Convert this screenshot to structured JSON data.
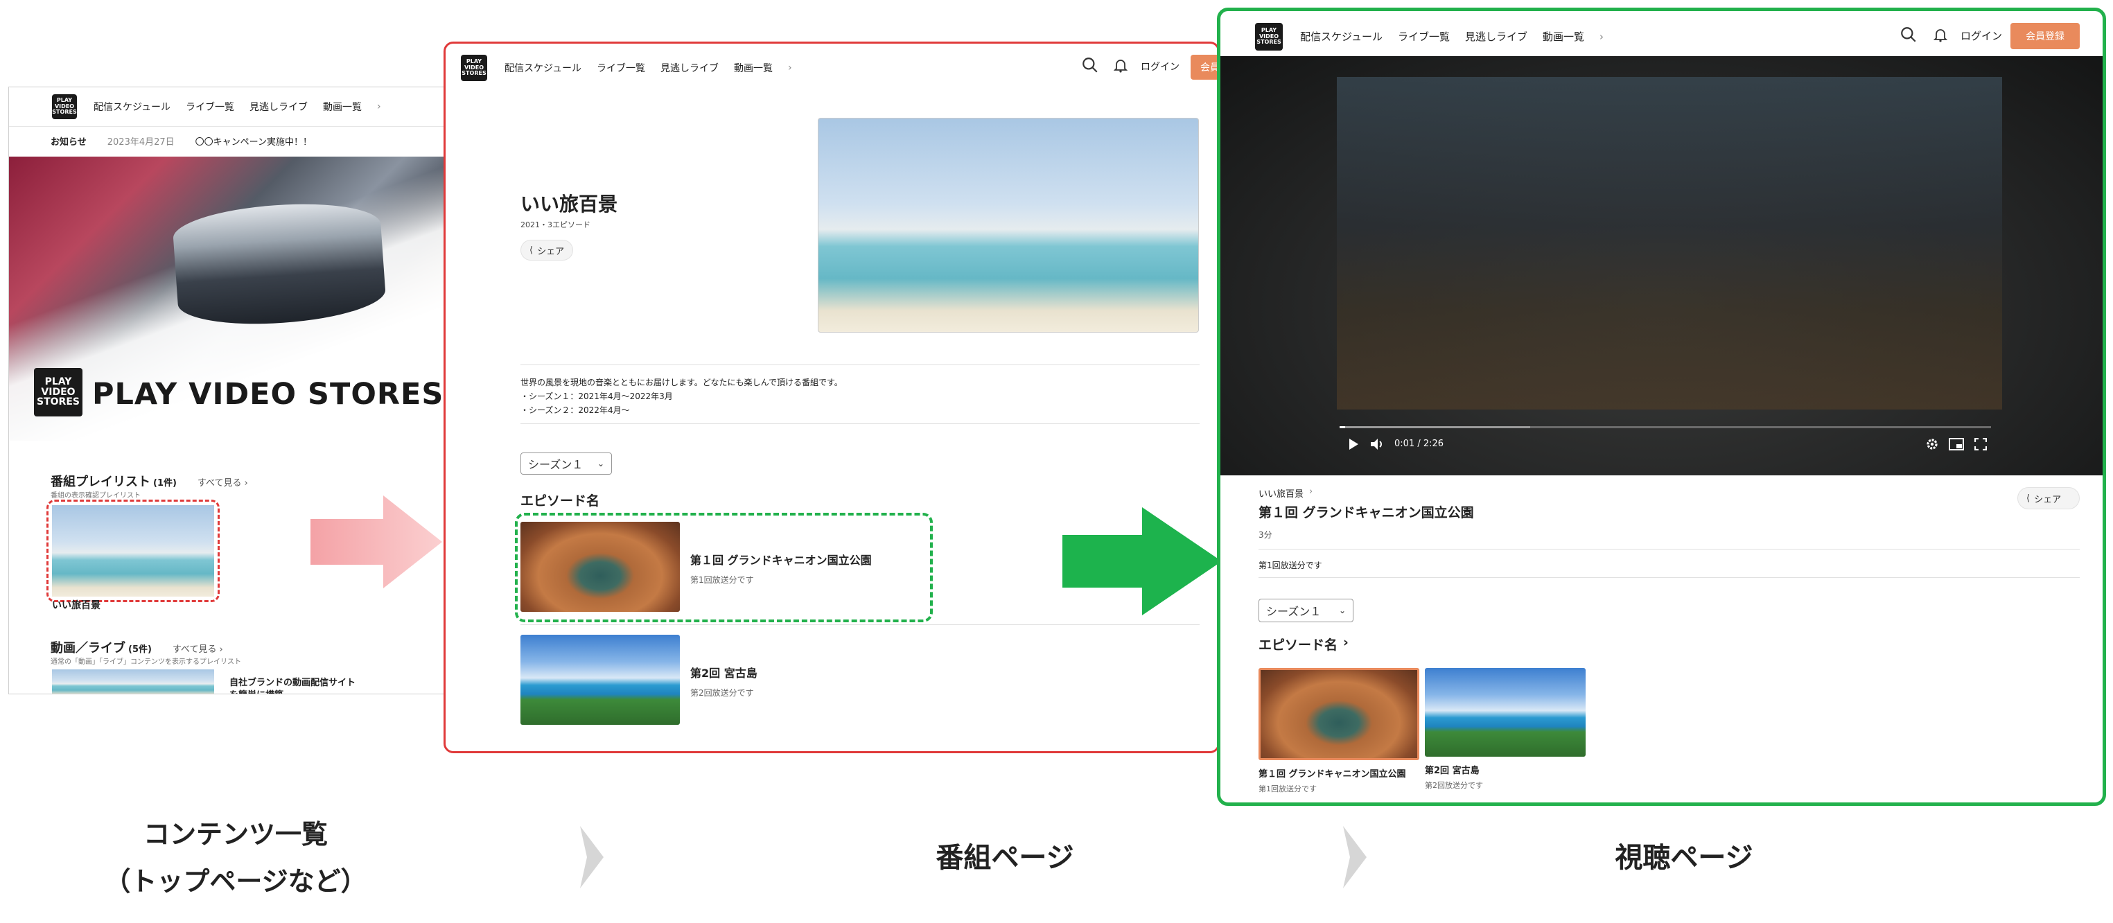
{
  "nav": {
    "schedule": "配信スケジュール",
    "live_list": "ライブ一覧",
    "missed_live": "見逃しライブ",
    "video_list": "動画一覧",
    "login": "ログイン",
    "register": "会員登録"
  },
  "logo": {
    "line1": "PLAY",
    "line2": "VIDEO",
    "line3": "STORES"
  },
  "panel1": {
    "notice_label": "お知らせ",
    "notice_date": "2023年4月27日",
    "notice_text": "〇〇キャンペーン実施中！！",
    "hero_title": "PLAY VIDEO STORES",
    "playlist_title": "番組プレイリスト",
    "playlist_count": "(1件)",
    "see_all": "すべて見る",
    "playlist_sub": "番組の表示確認プレイリスト",
    "playlist_item": "いい旅百景",
    "video_title": "動画／ライブ",
    "video_count": "(5件)",
    "video_sub": "通常の「動画」「ライブ」コンテンツを表示するプレイリスト",
    "video_item": "自社ブランドの動画配信サイト",
    "video_item2": "を簡単に構築"
  },
  "panel2": {
    "program_title": "いい旅百景",
    "program_meta": "2021・3エピソード",
    "share": "シェア",
    "desc1": "世界の風景を現地の音楽とともにお届けします。どなたにも楽しんで頂ける番組です。",
    "desc2": "・シーズン１：2021年4月〜2022年3月",
    "desc3": "・シーズン２：2022年4月〜",
    "season": "シーズン１",
    "episodes_heading": "エピソード名",
    "ep1_title": "第１回 グランドキャニオン国立公園",
    "ep1_sub": "第1回放送分です",
    "ep2_title": "第2回 宮古島",
    "ep2_sub": "第2回放送分です"
  },
  "panel3": {
    "time": "0:01 / 2:26",
    "program_link": "いい旅百景",
    "episode_title": "第１回 グランドキャニオン国立公園",
    "duration": "3分",
    "share": "シェア",
    "desc": "第1回放送分です",
    "season": "シーズン１",
    "episodes_heading": "エピソード名",
    "ep1_title": "第１回 グランドキャニオン国立公園",
    "ep1_sub": "第1回放送分です",
    "ep2_title": "第2回 宮古島",
    "ep2_sub": "第2回放送分です"
  },
  "captions": {
    "c1_line1": "コンテンツ一覧",
    "c1_line2": "（トップページなど）",
    "c2": "番組ページ",
    "c3": "視聴ページ"
  },
  "colors": {
    "red_border": "#e03a3a",
    "green_border": "#22b14c",
    "pink_arrow": "#f6a7a7",
    "green_arrow": "#1db34d",
    "register_btn": "#e98a5c"
  }
}
